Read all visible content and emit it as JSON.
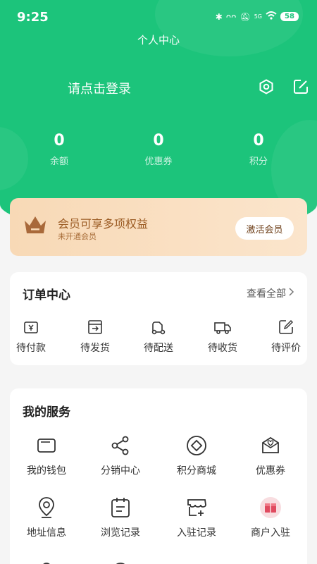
{
  "status": {
    "time": "9:25",
    "battery": "58",
    "network": "5G"
  },
  "header": {
    "title": "个人中心",
    "login_prompt": "请点击登录"
  },
  "stats": [
    {
      "value": "0",
      "label": "余额"
    },
    {
      "value": "0",
      "label": "优惠券"
    },
    {
      "value": "0",
      "label": "积分"
    }
  ],
  "member": {
    "title": "会员可享多项权益",
    "subtitle": "未开通会员",
    "button": "激活会员"
  },
  "orders": {
    "title": "订单中心",
    "view_all": "查看全部",
    "items": [
      {
        "label": "待付款",
        "icon": "wallet-icon"
      },
      {
        "label": "待发货",
        "icon": "ship-box-icon"
      },
      {
        "label": "待配送",
        "icon": "delivery-scooter-icon"
      },
      {
        "label": "待收货",
        "icon": "truck-icon"
      },
      {
        "label": "待评价",
        "icon": "review-pen-icon"
      }
    ]
  },
  "services": {
    "title": "我的服务",
    "items": [
      {
        "label": "我的钱包",
        "icon": "wallet-card-icon"
      },
      {
        "label": "分销中心",
        "icon": "share-icon"
      },
      {
        "label": "积分商城",
        "icon": "points-diamond-icon"
      },
      {
        "label": "优惠券",
        "icon": "coupon-envelope-icon"
      },
      {
        "label": "地址信息",
        "icon": "location-pin-icon"
      },
      {
        "label": "浏览记录",
        "icon": "history-list-icon"
      },
      {
        "label": "入驻记录",
        "icon": "store-add-icon"
      },
      {
        "label": "商户入驻",
        "icon": "merchant-gift-icon"
      }
    ]
  },
  "colors": {
    "primary": "#1cc47b",
    "member_text": "#9a5a22",
    "member_bg": "#f8d9b6"
  }
}
